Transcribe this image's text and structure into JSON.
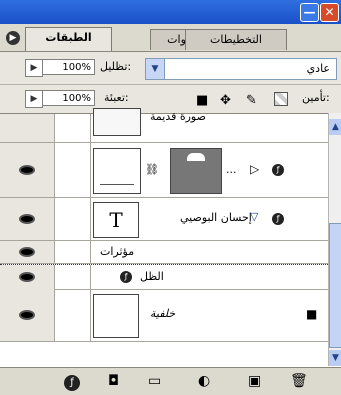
{
  "window": {
    "close_glyph": "✕",
    "min_glyph": "—"
  },
  "tabs": [
    {
      "label": "الطبقات",
      "active": true
    },
    {
      "label": "قنوات",
      "active": false
    },
    {
      "label": "التخطيطات",
      "active": false
    }
  ],
  "blend": {
    "mode": "عادي",
    "opacity_label": "تظليل:",
    "opacity_value": "100%"
  },
  "lock": {
    "label": "تأمين:",
    "fill_label": "تعبئة:",
    "fill_value": "100%"
  },
  "layers": [
    {
      "name": "صورة قديمة",
      "partial": true
    },
    {
      "name": "",
      "has_mask": true,
      "dots": "...",
      "kind": "shape"
    },
    {
      "name": "إحسان البوصيي",
      "kind": "text",
      "thumb_glyph": "T"
    },
    {
      "name": "مؤثرات",
      "kind": "effects-header"
    },
    {
      "name": "الظل",
      "kind": "effect"
    },
    {
      "name": "خلفية",
      "kind": "background"
    }
  ],
  "icons": {
    "fx": "ƒ",
    "eye": "eye",
    "lock": "🔒",
    "move": "✥",
    "brush": "✎"
  }
}
